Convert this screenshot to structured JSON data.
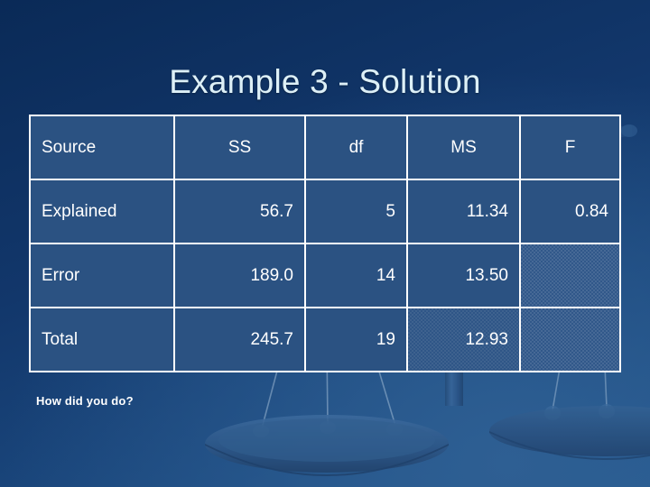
{
  "slide": {
    "title": "Example 3 - Solution",
    "footnote": "How did you do?",
    "background_top_color": "#0a2a57",
    "background_bottom_color": "#255a90",
    "title_color": "#ddf0f7",
    "table_border_color": "#ffffff",
    "table_cell_color": "#2b5282",
    "text_color": "#ffffff"
  },
  "table": {
    "headers": [
      "Source",
      "SS",
      "df",
      "MS",
      "F"
    ],
    "rows": [
      {
        "source": "Explained",
        "ss": "56.7",
        "df": "5",
        "ms": "11.34",
        "f": "0.84"
      },
      {
        "source": "Error",
        "ss": "189.0",
        "df": "14",
        "ms": "13.50",
        "f": ""
      },
      {
        "source": "Total",
        "ss": "245.7",
        "df": "19",
        "ms": "12.93",
        "f": ""
      }
    ]
  },
  "decoration": {
    "name": "balance-scale",
    "description": "faint balance scale watermark behind the slide content"
  }
}
